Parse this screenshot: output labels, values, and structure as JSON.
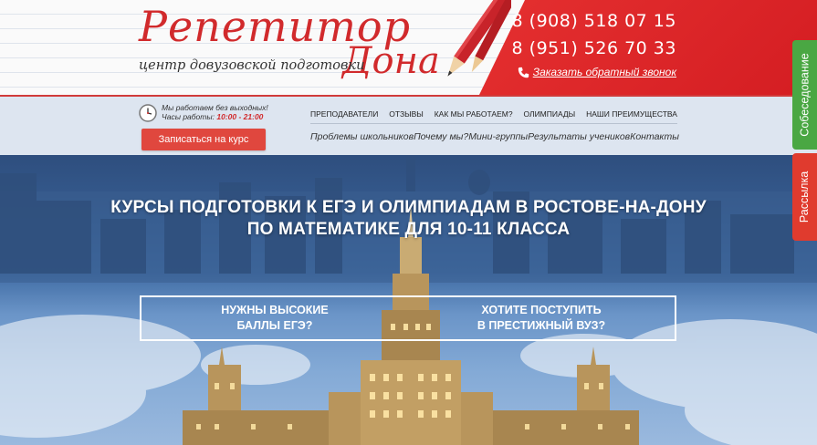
{
  "logo": {
    "line1": "Репетитор",
    "line2": "Дона",
    "tagline": "центр довузовской подготовки"
  },
  "contacts": {
    "phone1": "8 (908) 518 07 15",
    "phone2": "8 (951) 526 70 33",
    "callback_label": "Заказать обратный звонок"
  },
  "side_tabs": {
    "interview": "Собеседование",
    "mailing": "Рассылка"
  },
  "schedule": {
    "workdays": "Мы работаем без выходных!",
    "hours_label": "Часы работы:",
    "hours_value": "10:00 - 21:00"
  },
  "signup_button": "Записаться на курс",
  "nav_main": [
    "Преподаватели",
    "Отзывы",
    "Как мы работаем?",
    "Олимпиады",
    "Наши преимущества"
  ],
  "nav_sub": [
    "Проблемы школьников",
    "Почему мы?",
    "Мини-группы",
    "Результаты учеников",
    "Контакты"
  ],
  "hero": {
    "title_line1": "КУРСЫ ПОДГОТОВКИ К ЕГЭ И ОЛИМПИАДАМ В РОСТОВЕ-НА-ДОНУ",
    "title_line2": "ПО МАТЕМАТИКЕ ДЛЯ 10-11 КЛАССА",
    "cta_left_line1": "НУЖНЫ ВЫСОКИЕ",
    "cta_left_line2": "БАЛЛЫ ЕГЭ?",
    "cta_right_line1": "ХОТИТЕ ПОСТУПИТЬ",
    "cta_right_line2": "В ПРЕСТИЖНЫЙ ВУЗ?"
  },
  "colors": {
    "brand_red": "#d12a2c",
    "header_red": "#e53030",
    "nav_bg": "#dde5f0",
    "tab_green": "#4aa743",
    "tab_red": "#e03b2e"
  }
}
